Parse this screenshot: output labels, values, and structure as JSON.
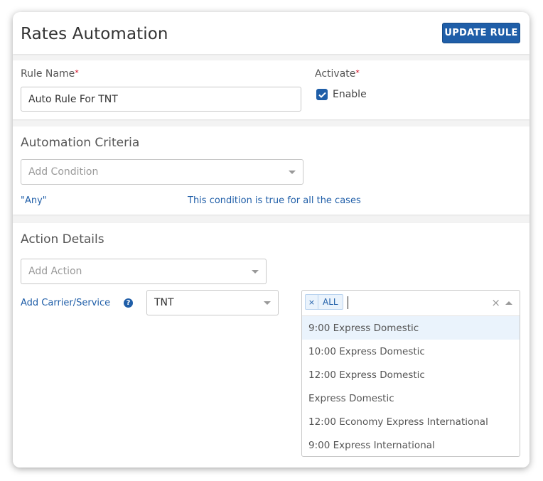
{
  "header": {
    "title": "Rates Automation",
    "update_button": "UPDATE RULE"
  },
  "rule": {
    "name_label": "Rule Name",
    "name_value": "Auto Rule For TNT",
    "activate_label": "Activate",
    "required_mark": "*",
    "enable_label": "Enable",
    "enable_checked": true
  },
  "criteria": {
    "title": "Automation Criteria",
    "add_condition_placeholder": "Add Condition",
    "condition_name": "\"Any\"",
    "condition_description": "This condition is true for all the cases"
  },
  "actions": {
    "title": "Action Details",
    "add_action_placeholder": "Add Action",
    "carrier_label": "Add Carrier/Service",
    "help_icon_glyph": "?",
    "carrier_value": "TNT",
    "services": {
      "selected_tags": [
        {
          "label": "ALL",
          "remove_glyph": "×"
        }
      ],
      "clear_glyph": "×",
      "options": [
        "9:00 Express Domestic",
        "10:00 Express Domestic",
        "12:00 Express Domestic",
        "Express Domestic",
        "12:00 Economy Express International",
        "9:00 Express International"
      ],
      "highlighted_index": 0
    }
  },
  "colors": {
    "primary": "#1f5ea8",
    "required": "#d0021b",
    "highlight": "#eaf3fc"
  }
}
